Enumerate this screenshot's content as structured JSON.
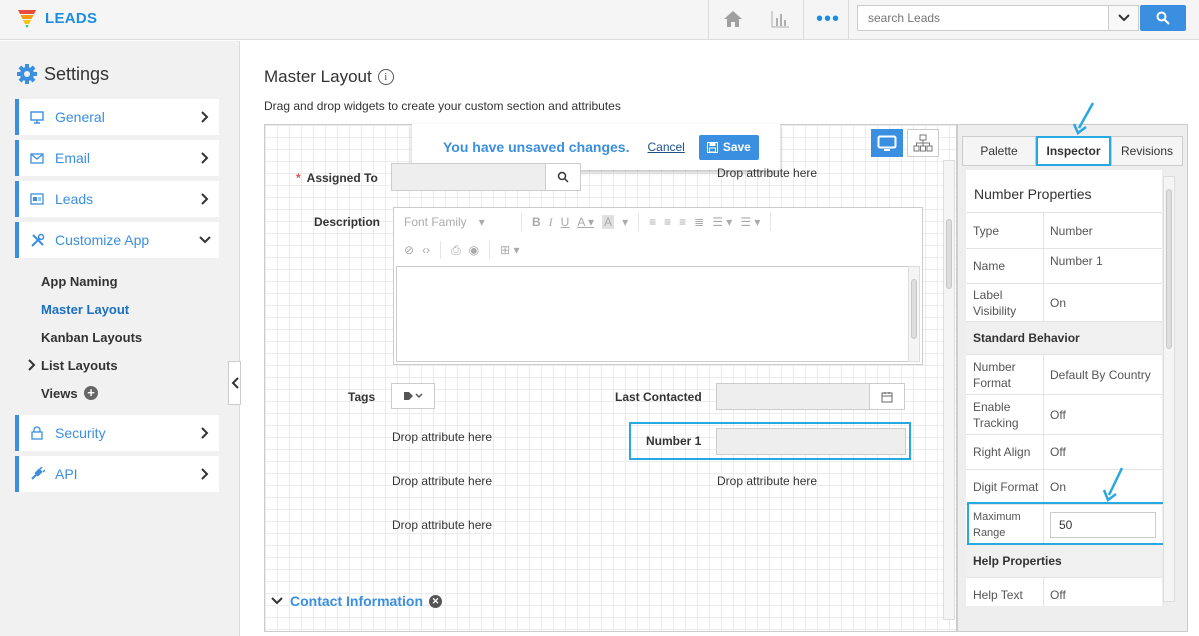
{
  "topbar": {
    "app_name": "LEADS",
    "search_placeholder": "search Leads",
    "icons": [
      "home-icon",
      "chart-icon",
      "more-icon",
      "search-icon"
    ]
  },
  "sidebar": {
    "title": "Settings",
    "items": [
      {
        "label": "General",
        "icon": "monitor-icon"
      },
      {
        "label": "Email",
        "icon": "envelope-icon"
      },
      {
        "label": "Leads",
        "icon": "card-icon"
      },
      {
        "label": "Customize App",
        "icon": "tools-icon"
      },
      {
        "label": "Security",
        "icon": "lock-icon"
      },
      {
        "label": "API",
        "icon": "plug-icon"
      }
    ],
    "subitems": [
      "App Naming",
      "Master Layout",
      "Kanban Layouts",
      "List Layouts",
      "Views"
    ]
  },
  "main": {
    "title": "Master Layout",
    "subtitle": "Drag and drop widgets to create your custom section and attributes",
    "unsaved": {
      "message": "You have unsaved changes.",
      "cancel": "Cancel",
      "save": "Save"
    },
    "fields": {
      "assigned_to": "Assigned To",
      "description": "Description",
      "tags": "Tags",
      "last_contacted": "Last Contacted",
      "number1": "Number 1"
    },
    "drop_text": "Drop attribute here",
    "editor": {
      "font_family": "Font Family"
    },
    "section": "Contact Information"
  },
  "panel": {
    "tabs": [
      "Palette",
      "Inspector",
      "Revisions"
    ],
    "title": "Number Properties",
    "rows": [
      {
        "k": "Type",
        "v": "Number"
      },
      {
        "k": "Name",
        "v": "Number 1"
      },
      {
        "k": "Label Visibility",
        "v": "On"
      }
    ],
    "standard_behavior": "Standard Behavior",
    "rows2": [
      {
        "k": "Number Format",
        "v": "Default By Country"
      },
      {
        "k": "Enable Tracking",
        "v": "Off"
      },
      {
        "k": "Right Align",
        "v": "Off"
      },
      {
        "k": "Digit Format",
        "v": "On"
      },
      {
        "k": "Maximum Range",
        "v": "50"
      }
    ],
    "help_properties": "Help Properties",
    "rows3": [
      {
        "k": "Help Text",
        "v": "Off"
      }
    ]
  },
  "colors": {
    "accent": "#3a8fe0",
    "highlight": "#28a8e0"
  }
}
